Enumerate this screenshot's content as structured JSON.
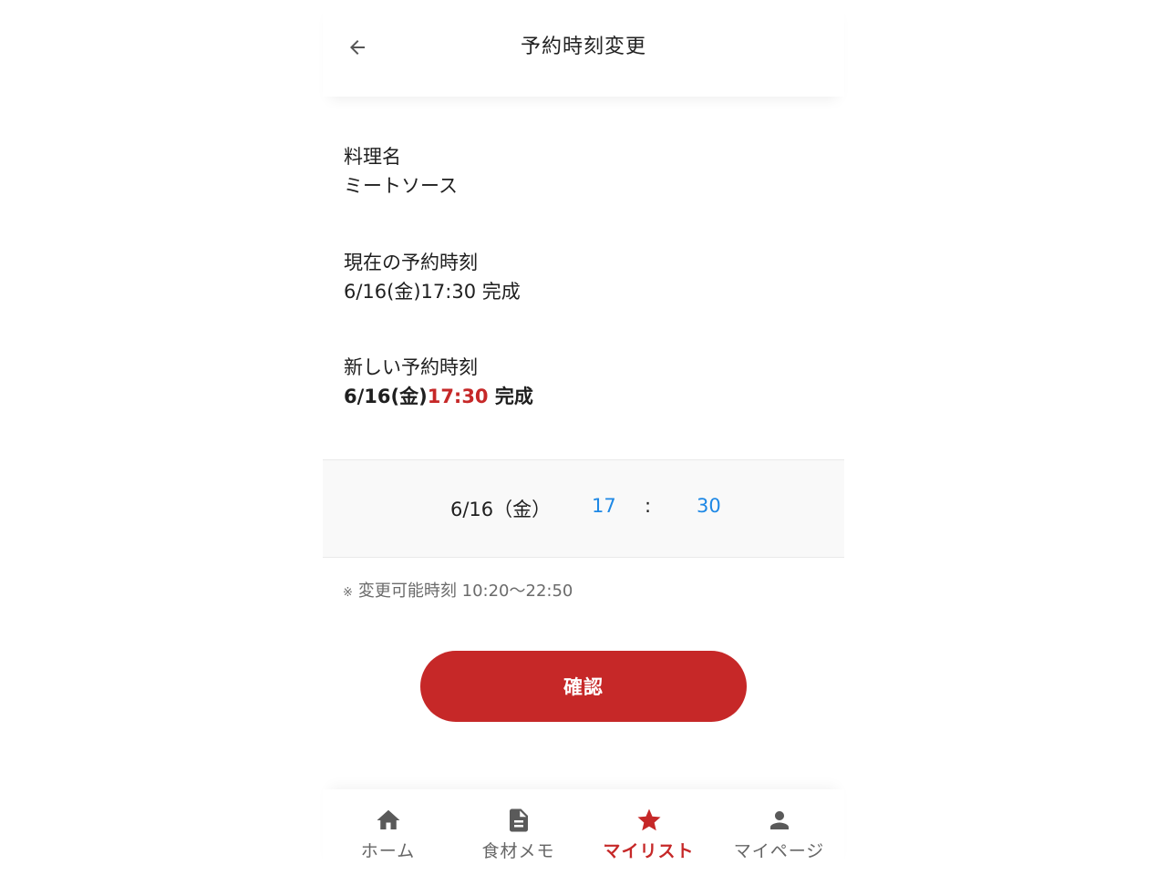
{
  "header": {
    "title": "予約時刻変更"
  },
  "dish": {
    "label": "料理名",
    "value": "ミートソース"
  },
  "current_time": {
    "label": "現在の予約時刻",
    "value": "6/16(金)17:30 完成"
  },
  "new_time": {
    "label": "新しい予約時刻",
    "date": "6/16(金)",
    "time": "17:30",
    "suffix": " 完成"
  },
  "picker": {
    "date": "6/16（金）",
    "hour": "17",
    "colon": ":",
    "minute": "30"
  },
  "note": {
    "mark": "※",
    "text": "変更可能時刻 10:20〜22:50"
  },
  "confirm_button": "確認",
  "nav": [
    {
      "label": "ホーム",
      "icon": "home-icon"
    },
    {
      "label": "食材メモ",
      "icon": "document-icon"
    },
    {
      "label": "マイリスト",
      "icon": "star-icon"
    },
    {
      "label": "マイページ",
      "icon": "person-icon"
    }
  ],
  "colors": {
    "accent": "#c62828",
    "picker_value": "#1e88e5",
    "nav_inactive": "#666666"
  }
}
